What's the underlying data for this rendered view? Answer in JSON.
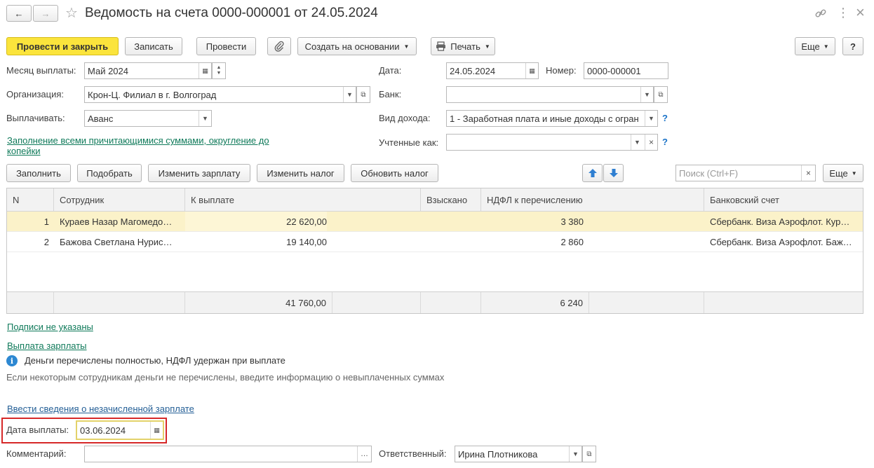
{
  "window": {
    "title": "Ведомость на счета 0000-000001 от 24.05.2024",
    "star": "☆",
    "back": "←",
    "forward": "→",
    "link_icon": "link-icon",
    "more_icon": "⋮",
    "close": "×"
  },
  "toolbar": {
    "post_close": "Провести и закрыть",
    "save": "Записать",
    "post": "Провести",
    "attach_icon": "paperclip-icon",
    "create_based": "Создать на основании",
    "print": "Печать",
    "more": "Еще",
    "help": "?"
  },
  "header": {
    "month_label": "Месяц выплаты:",
    "month_value": "Май 2024",
    "org_label": "Организация:",
    "org_value": "Крон-Ц. Филиал в г. Волгоград",
    "pay_label": "Выплачивать:",
    "pay_value": "Аванс",
    "fill_link": "Заполнение всеми причитающимися суммами, округление до",
    "fill_link_2": "копейки",
    "date_label": "Дата:",
    "date_value": "24.05.2024",
    "number_label": "Номер:",
    "number_value": "0000-000001",
    "bank_label": "Банк:",
    "bank_value": "",
    "income_label": "Вид дохода:",
    "income_value": "1 - Заработная плата и иные доходы с огран",
    "accounted_label": "Учтенные как:",
    "accounted_value": "",
    "help_mark": "?"
  },
  "table_toolbar": {
    "fill": "Заполнить",
    "pick": "Подобрать",
    "change_salary": "Изменить зарплату",
    "change_tax": "Изменить налог",
    "update_tax": "Обновить налог",
    "search_placeholder": "Поиск (Ctrl+F)",
    "more": "Еще"
  },
  "table": {
    "columns": [
      "N",
      "Сотрудник",
      "К выплате",
      "Взыскано",
      "НДФЛ к перечислению",
      "Банковский счет"
    ],
    "rows": [
      {
        "n": "1",
        "employee": "Кураев Назар Магомедо…",
        "pay": "22 620,00",
        "withheld": "",
        "ndfl": "3 380",
        "account": "Сбербанк. Виза Аэрофлот. Кур…"
      },
      {
        "n": "2",
        "employee": "Бажова Светлана Нурис…",
        "pay": "19 140,00",
        "withheld": "",
        "ndfl": "2 860",
        "account": "Сбербанк. Виза Аэрофлот. Баж…"
      }
    ],
    "total_pay": "41 760,00",
    "total_ndfl": "6 240"
  },
  "footer": {
    "signatures_link": "Подписи не указаны",
    "payment_link": "Выплата зарплаты",
    "info_text": "Деньги перечислены  полностью, НДФЛ удержан при выплате",
    "hint_text": "Если некоторым сотрудникам деньги не перечислены, введите информацию о невыплаченных суммах",
    "unpaid_link": "Ввести сведения о незачисленной зарплате",
    "pay_date_label": "Дата выплаты:",
    "pay_date_value": "03.06.2024",
    "comment_label": "Комментарий:",
    "comment_value": "",
    "responsible_label": "Ответственный:",
    "responsible_value": "Ирина Плотникова"
  },
  "colors": {
    "primary": "#fbe43c",
    "selected_row": "#fbf2c9",
    "link": "#0f7a5a",
    "highlight_border": "#d62828",
    "arrow_blue": "#2f7fd1"
  }
}
